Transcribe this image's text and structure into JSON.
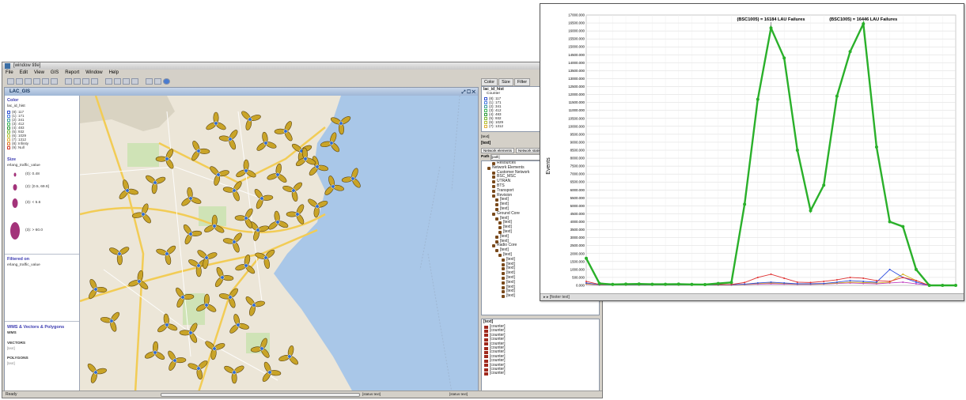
{
  "map_window": {
    "title": "[window title]",
    "menus": [
      "File",
      "Edit",
      "View",
      "GIS",
      "Report",
      "Window",
      "Help"
    ],
    "map_tab": "LAC_GIS",
    "status_left": "Ready",
    "status_right": "[status text]",
    "status_mid": "[status text]",
    "legend": {
      "color_heading": "Color",
      "color_field": "lac_id_hist",
      "color_items": [
        {
          "label": "(8): 117",
          "color": "#2f4fd0"
        },
        {
          "label": "(1): 171",
          "color": "#4a7ee0"
        },
        {
          "label": "(2): 341",
          "color": "#3fa0a0"
        },
        {
          "label": "(3): 412",
          "color": "#3fb55a"
        },
        {
          "label": "(4): 483",
          "color": "#2f9a3c"
        },
        {
          "label": "(5): 932",
          "color": "#7ab83a"
        },
        {
          "label": "(6): 1029",
          "color": "#b8c23a"
        },
        {
          "label": "(7): 1312",
          "color": "#e0b13a"
        },
        {
          "label": "(8): Infinity",
          "color": "#e07a2e"
        },
        {
          "label": "(9): Null",
          "color": "#d03a2a"
        }
      ],
      "size_heading": "Size",
      "size_field": "erlang_traffic_value",
      "size_items": [
        "(0): 0.48",
        "(2): [0.5, 69.9]",
        "(3): < 5.6",
        "(3): > 60.0"
      ],
      "filtered_heading": "Filtered on",
      "filtered_field": "erlang_traffic_value",
      "bottom_heading": "WMS & Vectors & Polygons",
      "bottom_items": [
        "WMS",
        "VECTORS",
        "[text]",
        "POLYGONS",
        "[text]"
      ]
    },
    "right_tabs": [
      "Color",
      "Size",
      "Filter"
    ],
    "right_list_header": "lac_id_hist",
    "right_list_sub": "Counter",
    "right_list_items": [
      "(8): 117",
      "(1): 171",
      "(2): 341",
      "(3): 412",
      "(4): 483",
      "(5): 932",
      "(6): 1029",
      "(7): 1312"
    ],
    "group_label": "[text]",
    "group_value": "[text]",
    "tree_buttons": [
      "Network elements",
      "Network statistics"
    ],
    "path_label": "Path",
    "path_value": "[path]",
    "tree_items": [
      "Resources",
      "Network Elements",
      "Customer Network",
      "BSC_MSC",
      "UTRAN",
      "BTS",
      "Transport",
      "Revision",
      "[text]",
      "[text]",
      "[text]",
      "Ground Core",
      "[text]",
      "[text]",
      "[text]",
      "[text]",
      "[text]",
      "[text]",
      "Radio Core",
      "[text]",
      "[text]",
      "[text]",
      "[text]",
      "[text]",
      "[text]",
      "[text]",
      "[text]",
      "[text]",
      "[text]",
      "[text]"
    ],
    "counters_heading": "[text]",
    "counter_items": [
      "[counter]",
      "[counter]",
      "[counter]",
      "[counter]",
      "[counter]",
      "[counter]",
      "[counter]",
      "[counter]",
      "[counter]",
      "[counter]",
      "[counter]",
      "[counter]"
    ]
  },
  "chart_window": {
    "footer": "[footer text]"
  },
  "chart_data": {
    "type": "line",
    "title": "",
    "ylabel": "Events",
    "xlabel": "",
    "ylim": [
      0,
      17000
    ],
    "yticks": [
      0,
      500,
      1000,
      1500,
      2000,
      2500,
      3000,
      3500,
      4000,
      4500,
      5000,
      5500,
      6000,
      6500,
      7000,
      7500,
      8000,
      8500,
      9000,
      9500,
      10000,
      10500,
      11000,
      11500,
      12000,
      12500,
      13000,
      13500,
      14000,
      14500,
      15000,
      15500,
      16000,
      16500,
      17000
    ],
    "ytick_labels": [
      "0.000",
      "500.000",
      "1000.000",
      "1500.000",
      "2000.000",
      "2500.000",
      "3000.000",
      "3500.000",
      "4000.000",
      "4500.000",
      "5000.000",
      "5500.000",
      "6000.000",
      "6500.000",
      "7000.000",
      "7500.000",
      "8000.000",
      "8500.000",
      "9000.000",
      "9500.000",
      "10000.000",
      "10500.000",
      "11000.000",
      "11500.000",
      "12000.000",
      "12500.000",
      "13000.000",
      "13500.000",
      "14000.000",
      "14500.000",
      "15000.000",
      "15500.000",
      "16000.000",
      "16500.000",
      "17000.000"
    ],
    "grid": true,
    "x": [
      0,
      1,
      2,
      3,
      4,
      5,
      6,
      7,
      8,
      9,
      10,
      11,
      12,
      13,
      14,
      15,
      16,
      17,
      18,
      19,
      20,
      21,
      22,
      23,
      24,
      25,
      26,
      27,
      28
    ],
    "series": [
      {
        "color": "#2ab02a",
        "values": [
          1700,
          120,
          60,
          80,
          90,
          70,
          70,
          80,
          60,
          50,
          120,
          180,
          5100,
          11700,
          16184,
          14300,
          8500,
          4700,
          6300,
          11900,
          14700,
          16446,
          8700,
          4000,
          3700,
          1000,
          0,
          0,
          0
        ]
      },
      {
        "color": "#e03030",
        "values": [
          250,
          60,
          40,
          40,
          50,
          40,
          40,
          40,
          40,
          40,
          50,
          60,
          180,
          500,
          700,
          450,
          200,
          180,
          250,
          350,
          500,
          450,
          300,
          250,
          500,
          300,
          0,
          0,
          0
        ]
      },
      {
        "color": "#3050e0",
        "values": [
          150,
          40,
          30,
          30,
          30,
          30,
          30,
          30,
          30,
          30,
          30,
          40,
          80,
          150,
          200,
          150,
          100,
          100,
          120,
          200,
          300,
          250,
          200,
          1000,
          500,
          200,
          0,
          0,
          0
        ]
      },
      {
        "color": "#d4b020",
        "values": [
          100,
          30,
          20,
          20,
          20,
          20,
          20,
          20,
          20,
          20,
          20,
          30,
          60,
          120,
          150,
          120,
          80,
          80,
          100,
          150,
          200,
          180,
          150,
          200,
          700,
          300,
          0,
          0,
          0
        ]
      },
      {
        "color": "#c040c0",
        "values": [
          80,
          20,
          20,
          20,
          20,
          20,
          20,
          20,
          20,
          20,
          20,
          20,
          50,
          80,
          100,
          80,
          60,
          60,
          80,
          120,
          150,
          120,
          100,
          150,
          200,
          100,
          0,
          0,
          0
        ]
      }
    ],
    "annotations": [
      {
        "text": "(BSC1005) = 16184 LAU Failures",
        "x": 14,
        "y": 16184
      },
      {
        "text": "(BSC1005) = 16446 LAU Failures",
        "x": 21,
        "y": 16446
      }
    ]
  }
}
